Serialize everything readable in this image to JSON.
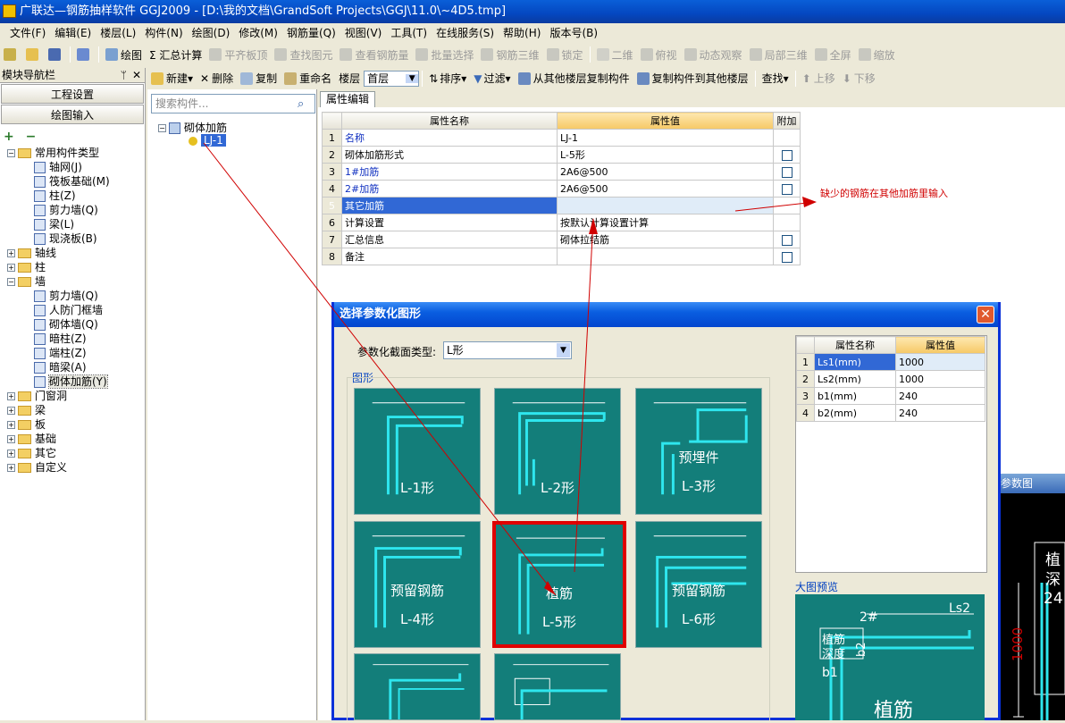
{
  "window": {
    "title": "广联达—钢筋抽样软件 GGJ2009 - [D:\\我的文档\\GrandSoft Projects\\GGJ\\11.0\\~4D5.tmp]"
  },
  "menu": [
    "文件(F)",
    "编辑(E)",
    "楼层(L)",
    "构件(N)",
    "绘图(D)",
    "修改(M)",
    "钢筋量(Q)",
    "视图(V)",
    "工具(T)",
    "在线服务(S)",
    "帮助(H)",
    "版本号(B)"
  ],
  "toolbar1": {
    "draw": "绘图",
    "calc": "Σ 汇总计算",
    "flat": "平齐板顶",
    "find": "查找图元",
    "view_rebar": "查看钢筋量",
    "batch": "批量选择",
    "rebar3d": "钢筋三维",
    "lock": "锁定",
    "view2d": "二维",
    "top": "俯视",
    "dyn": "动态观察",
    "local3d": "局部三维",
    "full": "全屏",
    "zoom": "缩放"
  },
  "toolbar2": {
    "new": "新建",
    "delete": "删除",
    "copy": "复制",
    "rename": "重命名",
    "floor_label": "楼层",
    "floor_value": "首层",
    "sort": "排序",
    "filter": "过滤",
    "copy_from": "从其他楼层复制构件",
    "copy_to": "复制构件到其他楼层",
    "find": "查找",
    "up": "上移",
    "down": "下移"
  },
  "left": {
    "title": "模块导航栏",
    "nav1": "工程设置",
    "nav2": "绘图输入",
    "tree": [
      {
        "label": "常用构件类型",
        "level": 0,
        "open": true,
        "folder": true
      },
      {
        "label": "轴网(J)",
        "level": 1
      },
      {
        "label": "筏板基础(M)",
        "level": 1
      },
      {
        "label": "柱(Z)",
        "level": 1
      },
      {
        "label": "剪力墙(Q)",
        "level": 1
      },
      {
        "label": "梁(L)",
        "level": 1
      },
      {
        "label": "现浇板(B)",
        "level": 1
      },
      {
        "label": "轴线",
        "level": 0,
        "folder": true
      },
      {
        "label": "柱",
        "level": 0,
        "folder": true
      },
      {
        "label": "墙",
        "level": 0,
        "open": true,
        "folder": true
      },
      {
        "label": "剪力墙(Q)",
        "level": 1
      },
      {
        "label": "人防门框墙",
        "level": 1
      },
      {
        "label": "砌体墙(Q)",
        "level": 1
      },
      {
        "label": "暗柱(Z)",
        "level": 1
      },
      {
        "label": "端柱(Z)",
        "level": 1
      },
      {
        "label": "暗梁(A)",
        "level": 1
      },
      {
        "label": "砌体加筋(Y)",
        "level": 1,
        "selected": true
      },
      {
        "label": "门窗洞",
        "level": 0,
        "folder": true
      },
      {
        "label": "梁",
        "level": 0,
        "folder": true
      },
      {
        "label": "板",
        "level": 0,
        "folder": true
      },
      {
        "label": "基础",
        "level": 0,
        "folder": true
      },
      {
        "label": "其它",
        "level": 0,
        "folder": true
      },
      {
        "label": "自定义",
        "level": 0,
        "folder": true
      }
    ]
  },
  "complist": {
    "placeholder": "搜索构件...",
    "root": "砌体加筋",
    "item": "LJ-1"
  },
  "props": {
    "tab": "属性编辑",
    "col_name": "属性名称",
    "col_value": "属性值",
    "col_extra": "附加",
    "rows": [
      {
        "n": "1",
        "name": "名称",
        "value": "LJ-1",
        "blue": true,
        "chk": false
      },
      {
        "n": "2",
        "name": "砌体加筋形式",
        "value": "L-5形",
        "blue": false,
        "chk": true
      },
      {
        "n": "3",
        "name": "1#加筋",
        "value": "2A6@500",
        "blue": true,
        "chk": true
      },
      {
        "n": "4",
        "name": "2#加筋",
        "value": "2A6@500",
        "blue": true,
        "chk": true
      },
      {
        "n": "5",
        "name": "其它加筋",
        "value": "",
        "blue": false,
        "chk": false,
        "sel": true
      },
      {
        "n": "6",
        "name": "计算设置",
        "value": "按默认计算设置计算",
        "blue": false,
        "chk": false
      },
      {
        "n": "7",
        "name": "汇总信息",
        "value": "砌体拉结筋",
        "blue": false,
        "chk": true
      },
      {
        "n": "8",
        "name": "备注",
        "value": "",
        "blue": false,
        "chk": true
      }
    ]
  },
  "annotation": "缺少的钢筋在其他加筋里输入",
  "dialog": {
    "title": "选择参数化图形",
    "section_label": "参数化截面类型:",
    "section_value": "L形",
    "group": "图形",
    "preview_label": "大图预览",
    "params_header": {
      "name": "属性名称",
      "value": "属性值"
    },
    "params": [
      {
        "n": "1",
        "name": "Ls1(mm)",
        "value": "1000"
      },
      {
        "n": "2",
        "name": "Ls2(mm)",
        "value": "1000"
      },
      {
        "n": "3",
        "name": "b1(mm)",
        "value": "240"
      },
      {
        "n": "4",
        "name": "b2(mm)",
        "value": "240"
      }
    ],
    "shapes": [
      {
        "caption": "L-1形",
        "sub": ""
      },
      {
        "caption": "L-2形",
        "sub": ""
      },
      {
        "caption": "L-3形",
        "sub": "预埋件"
      },
      {
        "caption": "L-4形",
        "sub": "预留钢筋"
      },
      {
        "caption": "L-5形",
        "sub": "植筋",
        "selected": true
      },
      {
        "caption": "L-6形",
        "sub": "预留钢筋"
      }
    ]
  },
  "blackpanel": {
    "title": "参数图",
    "text1": "植",
    "text2": "深",
    "text3": "24",
    "dim": "1000"
  },
  "preview": {
    "title": "植筋",
    "depth1": "植筋",
    "depth2": "深度"
  },
  "colors": {
    "teal": "#137e7a",
    "cyan": "#2ee6ee",
    "selected_border": "#e00000",
    "row_select": "#3168d5"
  }
}
